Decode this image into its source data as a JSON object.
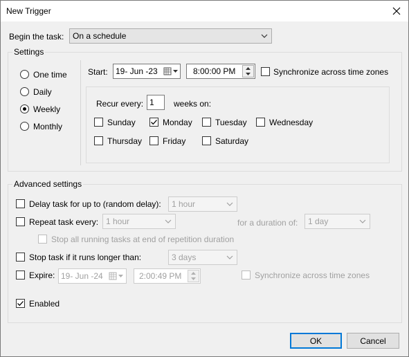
{
  "window": {
    "title": "New Trigger"
  },
  "begin": {
    "label": "Begin the task:",
    "value": "On a schedule"
  },
  "settings": {
    "title": "Settings",
    "schedule_options": [
      {
        "label": "One time",
        "selected": false
      },
      {
        "label": "Daily",
        "selected": false
      },
      {
        "label": "Weekly",
        "selected": true
      },
      {
        "label": "Monthly",
        "selected": false
      }
    ],
    "start_label": "Start:",
    "start_date": "19- Jun -23",
    "start_time": "8:00:00 PM",
    "sync_label": "Synchronize across time zones",
    "sync_checked": false,
    "recur_label": "Recur every:",
    "recur_value": "1",
    "weeks_on_label": "weeks on:",
    "days": [
      {
        "label": "Sunday",
        "checked": false
      },
      {
        "label": "Monday",
        "checked": true
      },
      {
        "label": "Tuesday",
        "checked": false
      },
      {
        "label": "Wednesday",
        "checked": false
      },
      {
        "label": "Thursday",
        "checked": false
      },
      {
        "label": "Friday",
        "checked": false
      },
      {
        "label": "Saturday",
        "checked": false
      }
    ]
  },
  "advanced": {
    "title": "Advanced settings",
    "delay": {
      "label": "Delay task for up to (random delay):",
      "value": "1 hour",
      "checked": false
    },
    "repeat": {
      "label": "Repeat task every:",
      "value": "1 hour",
      "checked": false,
      "duration_label": "for a duration of:",
      "duration_value": "1 day"
    },
    "stop_running": {
      "label": "Stop all running tasks at end of repetition duration",
      "checked": false
    },
    "stop_longer": {
      "label": "Stop task if it runs longer than:",
      "value": "3 days",
      "checked": false
    },
    "expire": {
      "label": "Expire:",
      "date": "19- Jun -24",
      "time": "2:00:49 PM",
      "checked": false,
      "sync_label": "Synchronize across time zones"
    },
    "enabled": {
      "label": "Enabled",
      "checked": true
    }
  },
  "buttons": {
    "ok": "OK",
    "cancel": "Cancel"
  }
}
